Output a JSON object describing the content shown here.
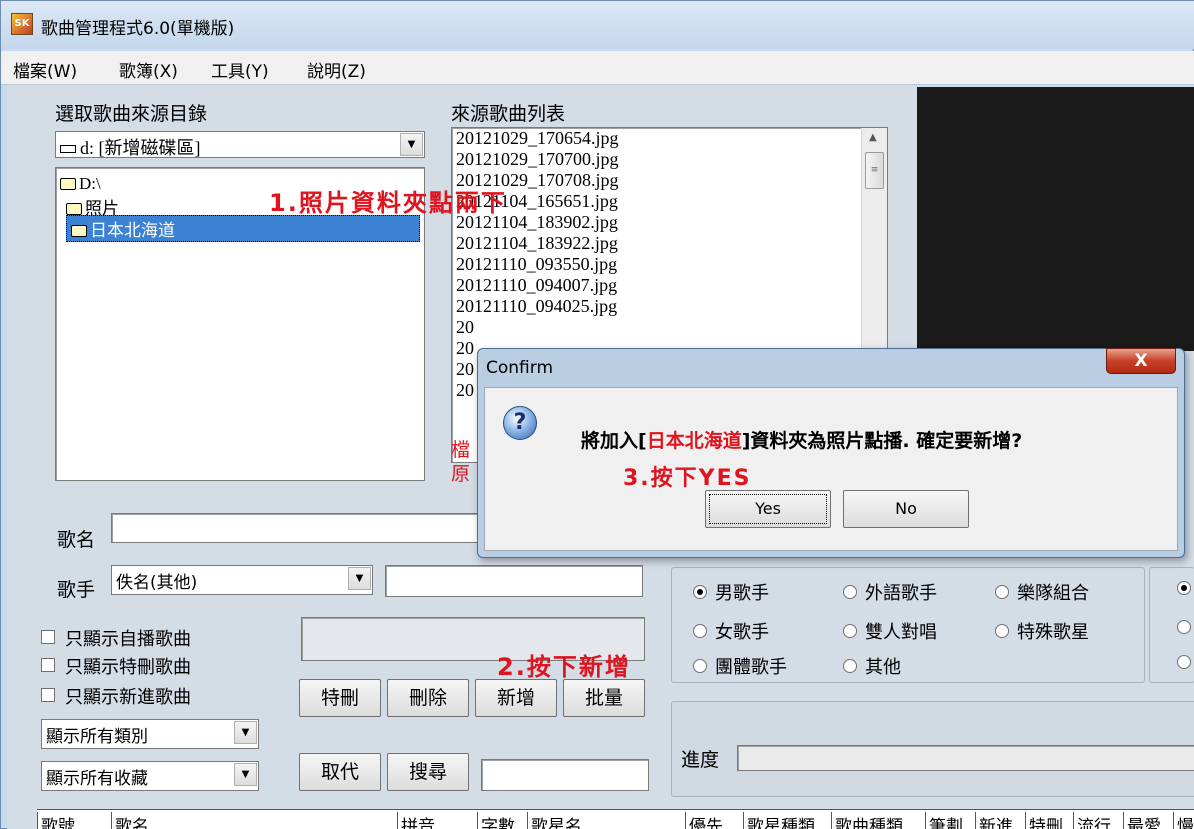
{
  "window": {
    "title": "歌曲管理程式6.0(單機版)",
    "icon": "SK"
  },
  "menu": [
    "檔案(W)",
    "歌簿(X)",
    "工具(Y)",
    "說明(Z)"
  ],
  "source_dir": {
    "label": "選取歌曲來源目錄",
    "drive": "d: [新增磁碟區]",
    "tree": [
      "D:\\",
      "照片",
      "日本北海道"
    ]
  },
  "song_list": {
    "label": "來源歌曲列表",
    "files": [
      "20121029_170654.jpg",
      "20121029_170700.jpg",
      "20121029_170708.jpg",
      "20121104_165651.jpg",
      "20121104_183902.jpg",
      "20121104_183922.jpg",
      "20121110_093550.jpg",
      "20121110_094007.jpg",
      "20121110_094025.jpg",
      "20",
      "20",
      "20",
      "20"
    ],
    "partial_labels": [
      "檔",
      "原"
    ]
  },
  "fields": {
    "song_name_label": "歌名",
    "singer_label": "歌手",
    "singer_value": "佚名(其他)"
  },
  "checks": [
    "只顯示自播歌曲",
    "只顯示特刪歌曲",
    "只顯示新進歌曲"
  ],
  "filters": {
    "category": "顯示所有類別",
    "collection": "顯示所有收藏"
  },
  "buttons": {
    "special_delete": "特刪",
    "delete": "刪除",
    "add": "新增",
    "batch": "批量",
    "replace": "取代",
    "search": "搜尋"
  },
  "singer_types": [
    {
      "label": "男歌手",
      "selected": true
    },
    {
      "label": "外語歌手",
      "selected": false
    },
    {
      "label": "樂隊組合",
      "selected": false
    },
    {
      "label": "女歌手",
      "selected": false
    },
    {
      "label": "雙人對唱",
      "selected": false
    },
    {
      "label": "特殊歌星",
      "selected": false
    },
    {
      "label": "團體歌手",
      "selected": false
    },
    {
      "label": "其他",
      "selected": false
    }
  ],
  "progress_label": "進度",
  "table_columns": [
    "歌號",
    "歌名",
    "拼音",
    "字數",
    "歌星名",
    "優先",
    "歌星種類",
    "歌曲種類",
    "筆劃",
    "新進",
    "特刪",
    "流行",
    "最愛",
    "慢"
  ],
  "annotations": {
    "step1": "1.照片資料夾點兩下",
    "step2": "2.按下新增",
    "step3": "3.按下YES"
  },
  "dialog": {
    "title": "Confirm",
    "close": "X",
    "msg_prefix": "將加入[",
    "msg_folder": "日本北海道",
    "msg_suffix": "]資料夾為照片點播. 確定要新增?",
    "yes": "Yes",
    "no": "No"
  },
  "colors": {
    "annotation": "#e0141e",
    "selection": "#3c82d2"
  }
}
